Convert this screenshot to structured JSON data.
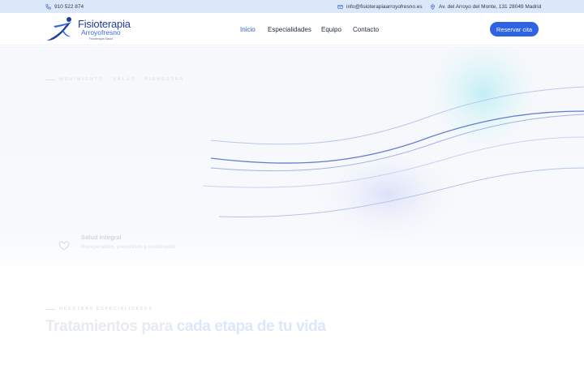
{
  "topbar": {
    "phone": "910 522 874",
    "email": "info@fisioterapiaarroyofresno.es",
    "address": "Av. del Arroyo del Monte, 131 28049 Madrid"
  },
  "brand": {
    "name_line1": "Fisioterapia",
    "name_line2": "Arroyofresno",
    "tagline": "Fisioterapia Salud"
  },
  "nav": {
    "items": [
      {
        "label": "Inicio",
        "active": true
      },
      {
        "label": "Especialidades",
        "active": false
      },
      {
        "label": "Equipo",
        "active": false
      },
      {
        "label": "Contacto",
        "active": false
      }
    ],
    "cta": "Reservar cita"
  },
  "hero": {
    "eyebrow": "MOVIMIENTO · SALUD · BIENESTAR",
    "feature": {
      "title": "Salud integral",
      "description": "Recuperación, prevención y rendimiento",
      "icon": "heart-icon"
    }
  },
  "section": {
    "eyebrow": "NUESTRAS ESPECIALIDADES",
    "title_plain": "Tratamientos para ",
    "title_highlight": "cada etapa de tu vida"
  },
  "colors": {
    "accent": "#2e63e3",
    "topbar_bg": "#dbe8f7",
    "nav_active": "#2f5fd9"
  }
}
